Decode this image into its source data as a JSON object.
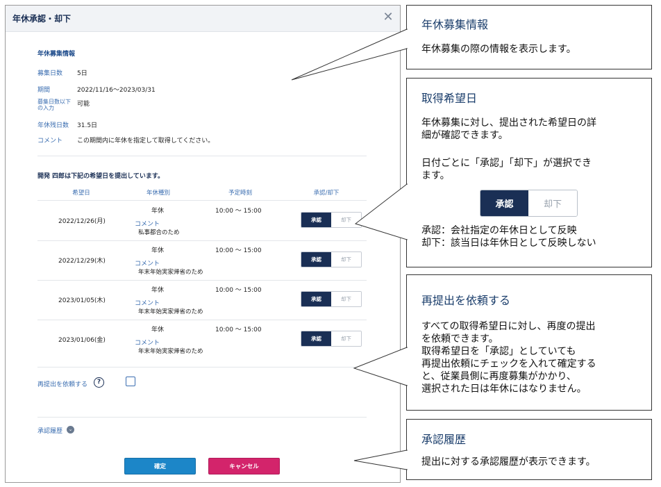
{
  "modal": {
    "title": "年休承認・却下",
    "close_icon": "close-icon",
    "recruit_section": {
      "title": "年休募集情報",
      "rows": [
        {
          "label": "募集日数",
          "value": "5日"
        },
        {
          "label": "期間",
          "value": "2022/11/16～2023/03/31"
        },
        {
          "label": "募集日数以下の入力",
          "value": "可能"
        },
        {
          "label": "年休残日数",
          "value": "31.5日"
        },
        {
          "label": "コメント",
          "value": "この期間内に年休を指定して取得してください。"
        }
      ]
    },
    "request_title": "開発 四郎は下記の希望日を提出しています。",
    "table": {
      "headers": [
        "希望日",
        "年休種別",
        "予定時刻",
        "承認/却下"
      ],
      "rows": [
        {
          "date": "2022/12/26(月)",
          "type": "年休",
          "time": "10:00 ～ 15:00",
          "comment_label": "コメント",
          "comment": "私事都合のため",
          "approve": "承認",
          "reject": "却下"
        },
        {
          "date": "2022/12/29(木)",
          "type": "年休",
          "time": "10:00 ～ 15:00",
          "comment_label": "コメント",
          "comment": "年末年始実家帰省のため",
          "approve": "承認",
          "reject": "却下"
        },
        {
          "date": "2023/01/05(木)",
          "type": "年休",
          "time": "10:00 ～ 15:00",
          "comment_label": "コメント",
          "comment": "年末年始実家帰省のため",
          "approve": "承認",
          "reject": "却下"
        },
        {
          "date": "2023/01/06(金)",
          "type": "年休",
          "time": "10:00 ～ 15:00",
          "comment_label": "コメント",
          "comment": "年末年始実家帰省のため",
          "approve": "承認",
          "reject": "却下"
        }
      ]
    },
    "resubmit_label": "再提出を依頼する",
    "help_icon": "?",
    "history_label": "承認履歴",
    "confirm_label": "確定",
    "cancel_label": "キャンセル"
  },
  "callouts": {
    "recruit": {
      "title": "年休募集情報",
      "text": "年休募集の際の情報を表示します。"
    },
    "wish": {
      "title": "取得希望日",
      "text1": "年休募集に対し、提出された希望日の詳\n細が確認できます。",
      "text2": "日付ごとに「承認」「却下」が選択でき\nます。",
      "sample_approve": "承認",
      "sample_reject": "却下",
      "text3": "承認：会社指定の年休日として反映\n却下：該当日は年休日として反映しない"
    },
    "resubmit": {
      "title": "再提出を依頼する",
      "text": "すべての取得希望日に対し、再度の提出\nを依頼できます。\n取得希望日を「承認」としていても\n再提出依頼にチェックを入れて確定する\nと、従業員側に再度募集がかかり、\n選択された日は年休にはなりません。"
    },
    "history": {
      "title": "承認履歴",
      "text": "提出に対する承認履歴が表示できます。"
    }
  },
  "colors": {
    "navy": "#1a2f55",
    "confirm": "#1c86c8",
    "cancel": "#d3246b",
    "label_blue": "#3a6db0"
  }
}
